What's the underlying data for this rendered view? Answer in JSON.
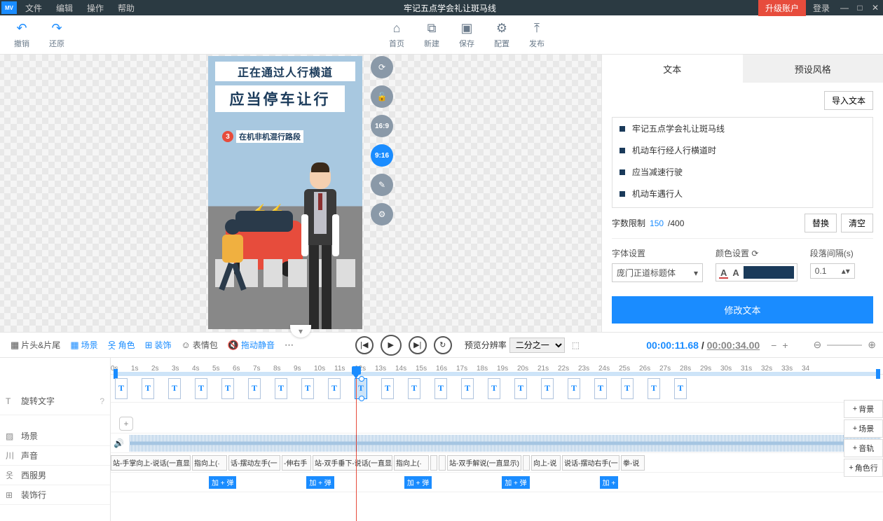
{
  "titlebar": {
    "menus": [
      "文件",
      "编辑",
      "操作",
      "帮助"
    ],
    "title": "牢记五点学会礼让斑马线",
    "upgrade": "升级账户",
    "login": "登录"
  },
  "toolbar": {
    "undo": "撤销",
    "redo": "还原",
    "home": "首页",
    "new": "新建",
    "save": "保存",
    "config": "配置",
    "publish": "发布"
  },
  "canvas": {
    "banner1": "正在通过人行横道",
    "banner2": "应当停车让行",
    "banner3_num": "3",
    "banner3_txt": "在机非机混行路段",
    "ratios": {
      "r1": "16:9",
      "r2": "9:16"
    }
  },
  "panel": {
    "tab_text": "文本",
    "tab_preset": "预设风格",
    "import": "导入文本",
    "items": [
      "牢记五点学会礼让斑马线",
      "机动车行经人行横道时",
      "应当减速行驶",
      "机动车遇行人"
    ],
    "count_label": "字数限制",
    "count_cur": "150",
    "count_sep": " /400",
    "replace": "替换",
    "clear": "清空",
    "font_label": "字体设置",
    "color_label": "颜色设置",
    "para_label": "段落间隔(s)",
    "font_value": "庞门正道标题体",
    "para_value": "0.1",
    "modify": "修改文本"
  },
  "controls": {
    "items": [
      {
        "label": "片头&片尾"
      },
      {
        "label": "场景"
      },
      {
        "label": "角色"
      },
      {
        "label": "装饰"
      },
      {
        "label": "表情包"
      },
      {
        "label": "拖动静音"
      }
    ],
    "preview_label": "预览分辨率",
    "preview_value": "二分之一",
    "time_cur": "00:00:11.68",
    "time_sep": " / ",
    "time_tot": "00:00:34.00"
  },
  "timeline": {
    "ruler": [
      "0s",
      "1s",
      "2s",
      "3s",
      "4s",
      "5s",
      "6s",
      "7s",
      "8s",
      "9s",
      "10s",
      "11s",
      "12s",
      "13s",
      "14s",
      "15s",
      "16s",
      "17s",
      "18s",
      "19s",
      "20s",
      "21s",
      "22s",
      "23s",
      "24s",
      "25s",
      "26s",
      "27s",
      "28s",
      "29s",
      "30s",
      "31s",
      "32s",
      "33s",
      "34"
    ],
    "tracks": {
      "text": "旋转文字",
      "scene": "场景",
      "audio": "声音",
      "character": "西服男",
      "deco": "装饰行"
    },
    "action_clips": [
      "站-手掌向上-说话(一直显",
      "指向上(·",
      "话-摆动左手(一",
      "-伸右手",
      "站-双手垂下-说话(一直显",
      "指向上(·",
      "",
      "",
      "站-双手解说(一直显示)",
      "",
      "向上-说",
      "说话-摆动右手(一",
      "拳-说"
    ],
    "deco_clips": [
      "加 + 弹",
      "加 + 弹",
      "加 + 弹",
      "加 + 弹",
      "加 +"
    ],
    "side_adds": [
      "背景",
      "场景",
      "音轨",
      "角色行"
    ]
  }
}
